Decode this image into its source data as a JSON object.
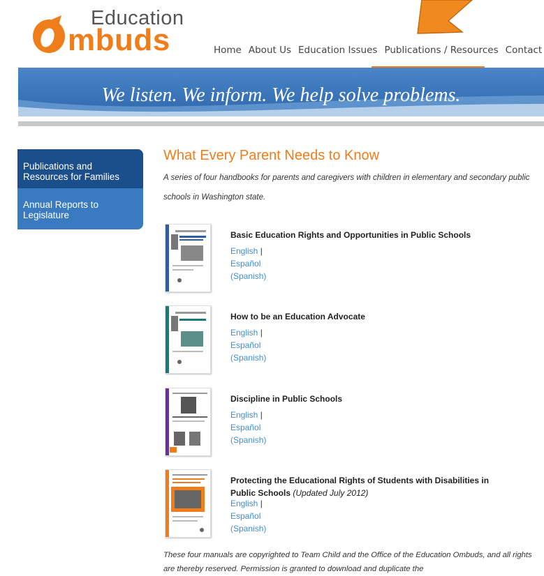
{
  "logo": {
    "line1": "Education",
    "line2": "mbuds"
  },
  "nav": [
    {
      "label": "Home"
    },
    {
      "label": "About Us"
    },
    {
      "label": "Education Issues"
    },
    {
      "label": "Publications / Resources",
      "active": true
    },
    {
      "label": "Contact Us"
    }
  ],
  "banner": {
    "tagline": "We listen.  We inform.  We help solve problems."
  },
  "sidebar": {
    "items": [
      {
        "label": "Publications and Resources for Families",
        "active": true
      },
      {
        "label": "Annual Reports to Legislature",
        "active": false
      }
    ]
  },
  "main": {
    "title": "What Every Parent Needs to Know",
    "intro": "A series of four handbooks for parents and caregivers with children in elementary and secondary public schools in Washington state.",
    "books": [
      {
        "title": "Basic Education Rights and Opportunities in Public Schools",
        "updated": "",
        "english": "English",
        "sep": "|",
        "spanish": "Español (Spanish)"
      },
      {
        "title": "How to be an Education Advocate",
        "updated": "",
        "english": "English",
        "sep": "|",
        "spanish": "Español (Spanish)"
      },
      {
        "title": "Discipline in Public Schools",
        "updated": "",
        "english": "English",
        "sep": "|",
        "spanish": "Español (Spanish)"
      },
      {
        "title": "Protecting the Educational Rights of Students with Disabilities in Public Schools",
        "updated": "(Updated July 2012)",
        "english": "English",
        "sep": "|",
        "spanish": "Español (Spanish)"
      }
    ],
    "footnote": "These four manuals are copyrighted to Team Child and the Office of the Education Ombuds, and all rights are thereby reserved. Permission is granted to download and duplicate the"
  },
  "colors": {
    "accent": "#ef7d1a",
    "nav_blue": "#3a7ac0",
    "nav_blue_dark": "#1b4f8c",
    "link": "#3a8fd8"
  }
}
